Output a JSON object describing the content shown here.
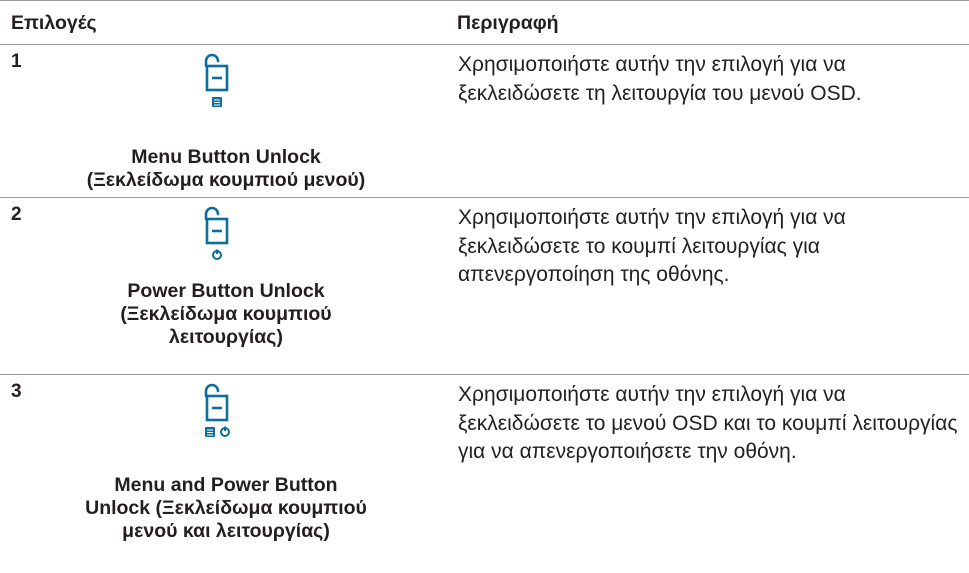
{
  "table": {
    "headers": {
      "options": "Επιλογές",
      "description": "Περιγραφή"
    },
    "rows": [
      {
        "number": "1",
        "icon": "unlock-menu-icon",
        "name_lines": [
          "Menu Button Unlock",
          "(Ξεκλείδωμα κουμπιού μενού)"
        ],
        "description": "Χρησιμοποιήστε αυτήν την επιλογή για να ξεκλειδώσετε τη λειτουργία του μενού OSD."
      },
      {
        "number": "2",
        "icon": "unlock-power-icon",
        "name_lines": [
          "Power Button Unlock",
          "(Ξεκλείδωμα κουμπιού",
          "λειτουργίας)"
        ],
        "description": "Χρησιμοποιήστε αυτήν την επιλογή για να ξεκλειδώσετε το κουμπί λειτουργίας για απενεργοποίηση της οθόνης."
      },
      {
        "number": "3",
        "icon": "unlock-menu-power-icon",
        "name_lines": [
          "Menu and Power Button",
          "Unlock (Ξεκλείδωμα κουμπιού",
          "μενού και λειτουργίας)"
        ],
        "description": "Χρησιμοποιήστε αυτήν την επιλογή για να ξεκλειδώσετε το μενού OSD και το κουμπί λειτουργίας για να απενεργοποιήσετε την οθόνη."
      }
    ]
  },
  "colors": {
    "icon": "#0a6e9e",
    "text": "#231f20",
    "rule": "#9a9a9a"
  }
}
